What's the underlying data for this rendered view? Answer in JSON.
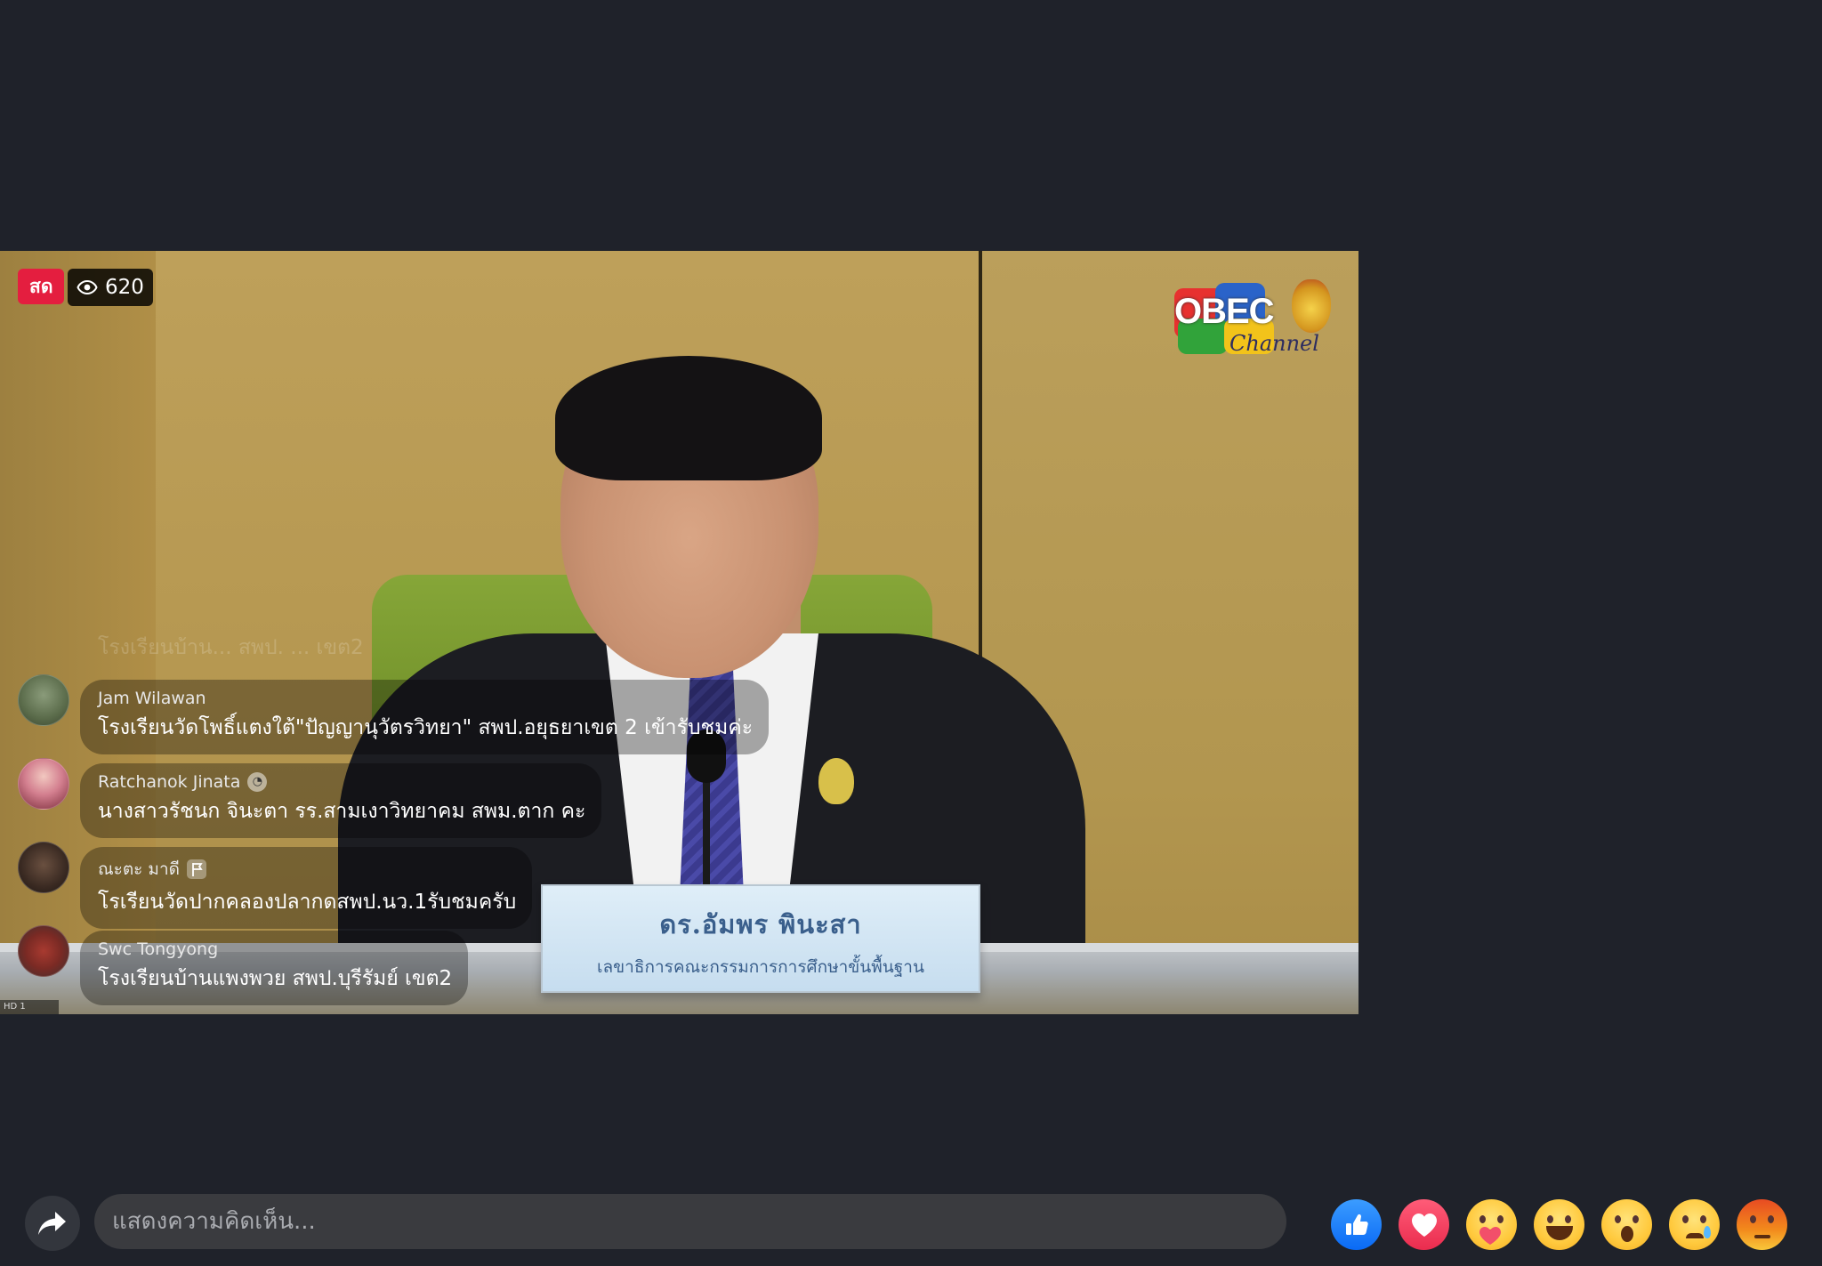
{
  "video": {
    "live_label": "สด",
    "viewer_count": "620",
    "logo_text": "OBEC",
    "logo_subtext": "Channel",
    "nameplate": {
      "name": "ดร.อัมพร พินะสา",
      "title": "เลขาธิการคณะกรรมการการศึกษาขั้นพื้นฐาน"
    },
    "ghost_comment": "โรงเรียนบ้าน... สพป. ... เขต2",
    "signal_text": "HD 1"
  },
  "comments": [
    {
      "name": "Jam Wilawan",
      "text": "โรงเรียนวัดโพธิ์แตงใต้\"ปัญญานุวัตรวิทยา\"  สพป.อยุธยาเขต 2 เข้ารับชมค่ะ",
      "badge": ""
    },
    {
      "name": "Ratchanok Jinata",
      "text": "นางสาวรัชนก จินะตา รร.สามเงาวิทยาคม สพม.ตาก คะ",
      "badge": "badge"
    },
    {
      "name": "ณะตะ มาดี",
      "text": "โรเรียนวัดปากคลองปลากดสพป.นว.1รับชมครับ",
      "badge": "flag"
    },
    {
      "name": "Swc Tongyong",
      "text": "โรงเรียนบ้านแพงพวย สพป.บุรีรัมย์ เขต2",
      "badge": ""
    }
  ],
  "composer": {
    "placeholder": "แสดงความคิดเห็น..."
  },
  "reactions": [
    "like",
    "love",
    "care",
    "haha",
    "wow",
    "sad",
    "angry"
  ],
  "colors": {
    "background": "#1f222a",
    "live_red": "#e41e3f",
    "like_blue": "#0a6af5",
    "love_red": "#ea2c4e"
  }
}
